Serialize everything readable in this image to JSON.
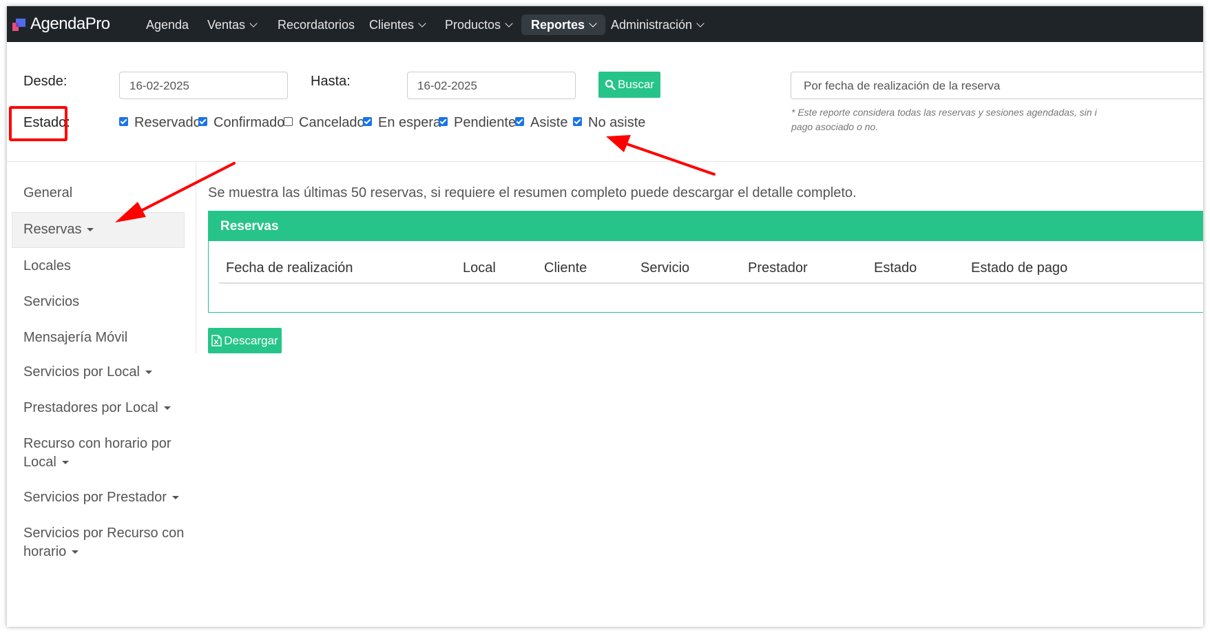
{
  "navbar": {
    "brand": "AgendaPro",
    "items": [
      {
        "label": "Agenda"
      },
      {
        "label": "Ventas"
      },
      {
        "label": "Recordatorios"
      },
      {
        "label": "Clientes"
      },
      {
        "label": "Productos"
      },
      {
        "label": "Reportes"
      },
      {
        "label": "Administración"
      }
    ],
    "active": "Reportes"
  },
  "filters": {
    "desde_label": "Desde:",
    "desde_value": "16-02-2025",
    "hasta_label": "Hasta:",
    "hasta_value": "16-02-2025",
    "buscar_label": "Buscar",
    "report_type": "Por fecha de realización de la reserva",
    "estado_label": "Estado:",
    "estados": [
      {
        "label": "Reservado",
        "checked": true
      },
      {
        "label": "Confirmado",
        "checked": true
      },
      {
        "label": "Cancelado",
        "checked": false
      },
      {
        "label": "En espera",
        "checked": true
      },
      {
        "label": "Pendiente",
        "checked": true
      },
      {
        "label": "Asiste",
        "checked": true
      },
      {
        "label": "No asiste",
        "checked": true
      }
    ],
    "note_line1": "* Este reporte considera todas las reservas y sesiones agendadas, sin i",
    "note_line2": "pago asociado o no."
  },
  "sidebar": {
    "items": [
      {
        "label": "General"
      },
      {
        "label": "Reservas"
      },
      {
        "label": "Locales"
      },
      {
        "label": "Servicios"
      },
      {
        "label": "Mensajería Móvil"
      },
      {
        "label": "Servicios por Local"
      },
      {
        "label": "Prestadores por Local"
      },
      {
        "label_line1": "Recurso con horario por",
        "label_line2": "Local"
      },
      {
        "label": "Servicios por Prestador"
      },
      {
        "label_line1": "Servicios por Recurso con",
        "label_line2": "horario"
      }
    ],
    "active": "Reservas"
  },
  "main": {
    "message": "Se muestra las últimas 50 reservas, si requiere el resumen completo puede descargar el detalle completo.",
    "panel_title": "Reservas",
    "columns": [
      "Fecha de realización",
      "Local",
      "Cliente",
      "Servicio",
      "Prestador",
      "Estado",
      "Estado de pago"
    ],
    "download_label": "Descargar"
  },
  "colors": {
    "accent_green": "#26c489",
    "navbar_bg": "#1f2428",
    "annotation_red": "#ff0000",
    "checkbox_blue": "#1a73e8"
  }
}
